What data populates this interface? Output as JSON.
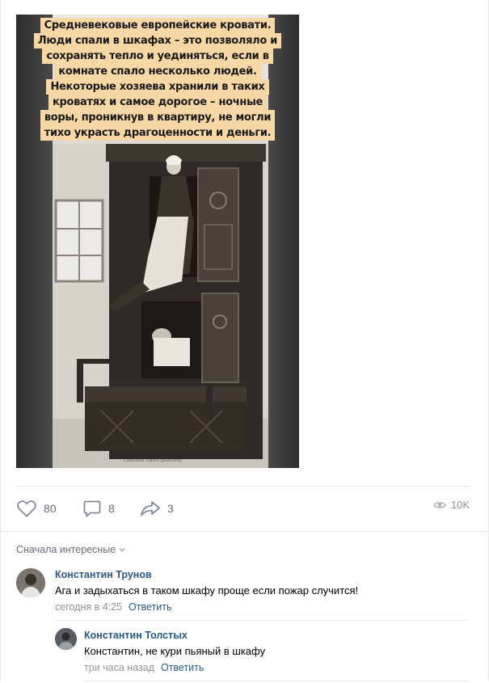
{
  "post": {
    "caption_lines": [
      "Средневековые европейские кровати.",
      "Люди спали в шкафах – это позволяло и",
      "сохранять тепло и уединяться, если в",
      "комнате спало несколько людей.",
      "Некоторые хозяева хранили в таких",
      "кроватях и самое дорогое – ночные",
      "воры, проникнув в квартиру, не могли",
      "тихо украсть драгоценности и деньги."
    ],
    "photo_label_bottom": "Collection Villard  (postcard)"
  },
  "actions": {
    "likes": "80",
    "comments": "8",
    "shares": "3",
    "views": "10K"
  },
  "comments_section": {
    "sort_label": "Сначала интересные"
  },
  "comments": [
    {
      "author": "Константин Трунов",
      "text": "Ага и задыхаться в таком шкафу проще если пожар случится!",
      "date": "сегодня в 4:25",
      "reply_label": "Ответить"
    },
    {
      "author": "Константин Толстых",
      "text": "Константин, не кури пьяный в шкафу",
      "date": "три часа назад",
      "reply_label": "Ответить"
    }
  ],
  "colors": {
    "link": "#2a5885",
    "muted": "#939393",
    "caption_bg": "#f6d7a5",
    "icon": "#828a99"
  }
}
